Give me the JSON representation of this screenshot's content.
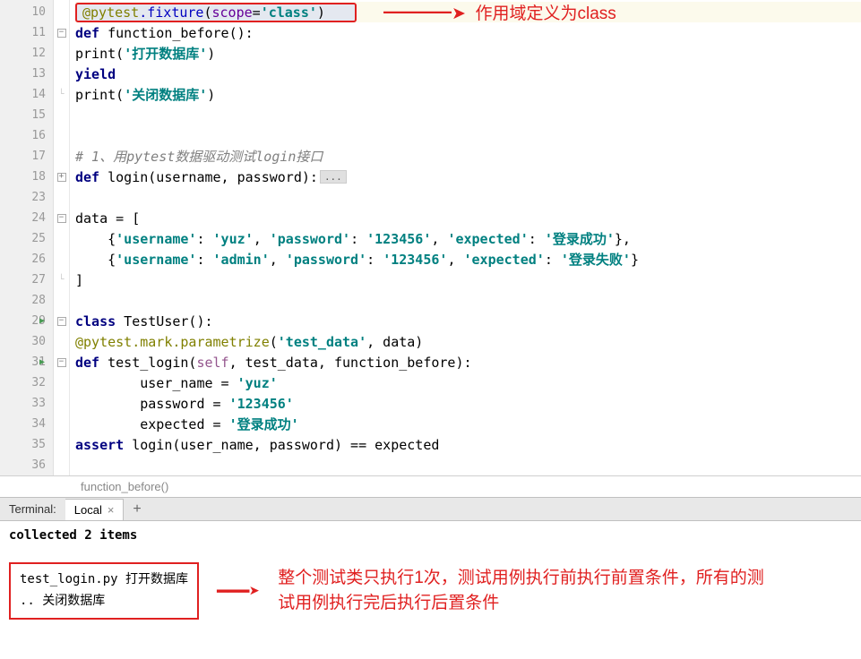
{
  "gutter": [
    "10",
    "11",
    "12",
    "13",
    "14",
    "15",
    "16",
    "17",
    "18",
    "23",
    "24",
    "25",
    "26",
    "27",
    "28",
    "29",
    "30",
    "31",
    "32",
    "33",
    "34",
    "35",
    "36"
  ],
  "code": {
    "l10_dec": "@pytest",
    "l10_fix": ".fixture",
    "l10_scope": "scope",
    "l10_class": "'class'",
    "l11_def": "def",
    "l11_fn": " function_before():",
    "l12_print": "print",
    "l12_arg": "'打开数据库'",
    "l13_yield": "yield",
    "l14_print": "print",
    "l14_arg": "'关闭数据库'",
    "l17": "# 1、用pytest数据驱动测试login接口",
    "l18_def": "def",
    "l18_fn": " login(username, password):",
    "l24": "data = [",
    "l25_open": "    {",
    "l25_k1": "'username'",
    "l25_v1": "'yuz'",
    "l25_k2": "'password'",
    "l25_v2": "'123456'",
    "l25_k3": "'expected'",
    "l25_v3": "'登录成功'",
    "l26_open": "    {",
    "l26_k1": "'username'",
    "l26_v1": "'admin'",
    "l26_k2": "'password'",
    "l26_v2": "'123456'",
    "l26_k3": "'expected'",
    "l26_v3": "'登录失败'",
    "l27": "]",
    "l29_class": "class",
    "l29_name": " TestUser():",
    "l30_dec": "@pytest.mark.parametrize",
    "l30_arg1": "'test_data'",
    "l30_arg2": ", data)",
    "l31_def": "def",
    "l31_fn": " test_login(",
    "l31_self": "self",
    "l31_rest": ", test_data, function_before):",
    "l32": "        user_name = ",
    "l32_v": "'yuz'",
    "l33": "        password = ",
    "l33_v": "'123456'",
    "l34": "        expected = ",
    "l34_v": "'登录成功'",
    "l35_assert": "assert",
    "l35_rest": " login(user_name, password) == expected"
  },
  "annotations": {
    "top": "作用域定义为class",
    "bottom": "整个测试类只执行1次，测试用例执行前执行前置条件，所有的测试用例执行完后执行后置条件"
  },
  "breadcrumb": "function_before()",
  "terminal": {
    "label": "Terminal:",
    "tab": "Local",
    "collected": "collected 2 items",
    "line1": "test_login.py 打开数据库",
    "line2": ".. 关闭数据库"
  }
}
